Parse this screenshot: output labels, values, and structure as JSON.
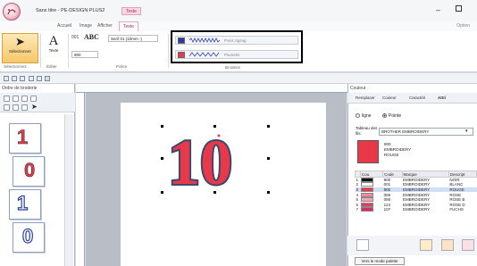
{
  "window": {
    "title": "Sans titre - PE-DESIGN PLUS2",
    "context_tab": "Texte"
  },
  "ribbon_tabs": [
    "Accueil",
    "Image",
    "Afficher",
    "Texte"
  ],
  "ribbon_tabs_right": "Option",
  "ribbon": {
    "selection_label": "Sélectionner",
    "selection_group": "Sélectionnez",
    "texte_label": "Texte",
    "edit_group": "Éditer",
    "font_number": "001",
    "font_sample": "ABC",
    "font_name": "Serif 01 (10mm -)",
    "font_size": "800",
    "police_group": "Police",
    "brodeur_group": "Broderie",
    "stitch_rows": [
      {
        "color": "#2a3fa0",
        "label": "Point zigzag"
      },
      {
        "color": "#e8384a",
        "label": "Plumetis"
      }
    ]
  },
  "left_panel": {
    "title": "Ordre de broderie",
    "items": [
      {
        "char": "1",
        "color": "#e8384a"
      },
      {
        "char": "0",
        "color": "#e8384a"
      },
      {
        "char": "1",
        "color": "#2a3fa0"
      },
      {
        "char": "0",
        "color": "#2a3fa0"
      }
    ]
  },
  "design": {
    "text": "10",
    "fill_color": "#e8384a",
    "outline_color": "#3a4b6e"
  },
  "right_panel": {
    "title": "Couleur",
    "tabs": [
      "Remplacer",
      "Couleur",
      "Caractéri",
      "Attri"
    ],
    "radio_ligne": "ligne",
    "radio_pointe": "Pointe",
    "tableau_label": "Tableau des fils:",
    "tableau_value": "BROTHER EMBROIDERY",
    "selected": {
      "code": "800",
      "brand": "EMBROIDERY",
      "name": "ROUGE",
      "color": "#e8384a"
    },
    "table_headers": [
      "",
      "Cou.",
      "Code",
      "Marque",
      "Descript"
    ],
    "rows": [
      {
        "num": "1",
        "color": "#111111",
        "code": "900",
        "brand": "EMBROIDERY",
        "desc": "NOIR"
      },
      {
        "num": "2",
        "color": "#ffffff",
        "code": "001",
        "brand": "EMBROIDERY",
        "desc": "BLANC"
      },
      {
        "num": "3",
        "color": "#e8384a",
        "code": "800",
        "brand": "EMBROIDERY",
        "desc": "ROUGE"
      },
      {
        "num": "4",
        "color": "#f08aa0",
        "code": "085",
        "brand": "EMBROIDERY",
        "desc": "ROSE"
      },
      {
        "num": "5",
        "color": "#f4a6b8",
        "code": "086",
        "brand": "EMBROIDERY",
        "desc": "ROSE B"
      },
      {
        "num": "6",
        "color": "#e6405e",
        "code": "124",
        "brand": "EMBROIDERY",
        "desc": "ROSE D"
      },
      {
        "num": "7",
        "color": "#d72a6a",
        "code": "107",
        "brand": "EMBROIDERY",
        "desc": "FUCHS"
      }
    ],
    "palette_button": "Vers le mode palette"
  }
}
